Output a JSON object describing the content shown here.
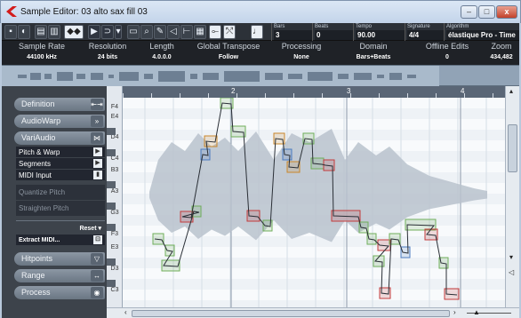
{
  "window": {
    "title": "Sample Editor: 03 alto sax fill 03",
    "min": "–",
    "max": "□",
    "close": "x"
  },
  "toolbar": {
    "bars_label": "Bars",
    "bars_value": "3",
    "beats_label": "Beats",
    "beats_value": "0",
    "tempo_label": "Tempo",
    "tempo_value": "90.00",
    "signature_label": "Signature",
    "signature_value": "4/4",
    "algorithm_label": "Algorithm",
    "algorithm_value": "élastique Pro - Time"
  },
  "info": {
    "columns": [
      {
        "header": "Sample Rate",
        "value": "44100        kHz"
      },
      {
        "header": "Resolution",
        "value": "24          bits"
      },
      {
        "header": "Length",
        "value": "4.0.0.0"
      },
      {
        "header": "Global Transpose",
        "value": "Follow"
      },
      {
        "header": "Processing",
        "value": "None"
      },
      {
        "header": "Domain",
        "value": "Bars+Beats"
      },
      {
        "header": "Offline Edits",
        "value": "0"
      },
      {
        "header": "Zoom",
        "value": "434,482"
      }
    ]
  },
  "left": {
    "definition": "Definition",
    "audiowarp": "AudioWarp",
    "variaudio": "VariAudio",
    "pitch_warp": "Pitch & Warp",
    "segments": "Segments",
    "midi_input": "MIDI Input",
    "quantize_pitch": "Quantize Pitch",
    "straighten_pitch": "Straighten Pitch",
    "reset": "Reset",
    "extract_midi": "Extract MIDI...",
    "hitpoints": "Hitpoints",
    "range": "Range",
    "process": "Process"
  },
  "keys": [
    "F4",
    "E4",
    "D4",
    "C4",
    "B3",
    "A3",
    "G3",
    "F3",
    "E3",
    "D3",
    "C3"
  ],
  "ruler": [
    "2",
    "3",
    "4"
  ],
  "icons": [
    "sample-editor-icon",
    "solo-icon",
    "waveform-icon",
    "snap-icon",
    "play-icon",
    "loop-icon",
    "range-select-icon",
    "zoom-icon",
    "pencil-icon",
    "speaker-icon",
    "hitpoint-icon",
    "grid-icon",
    "warp-icon",
    "stretch-icon",
    "metronome-icon"
  ],
  "colors": {
    "accent": "#2f6fd6",
    "segment_green": "#6fae5a",
    "segment_red": "#c23b3b",
    "segment_orange": "#c9872a",
    "segment_blue": "#4a7bc0"
  }
}
